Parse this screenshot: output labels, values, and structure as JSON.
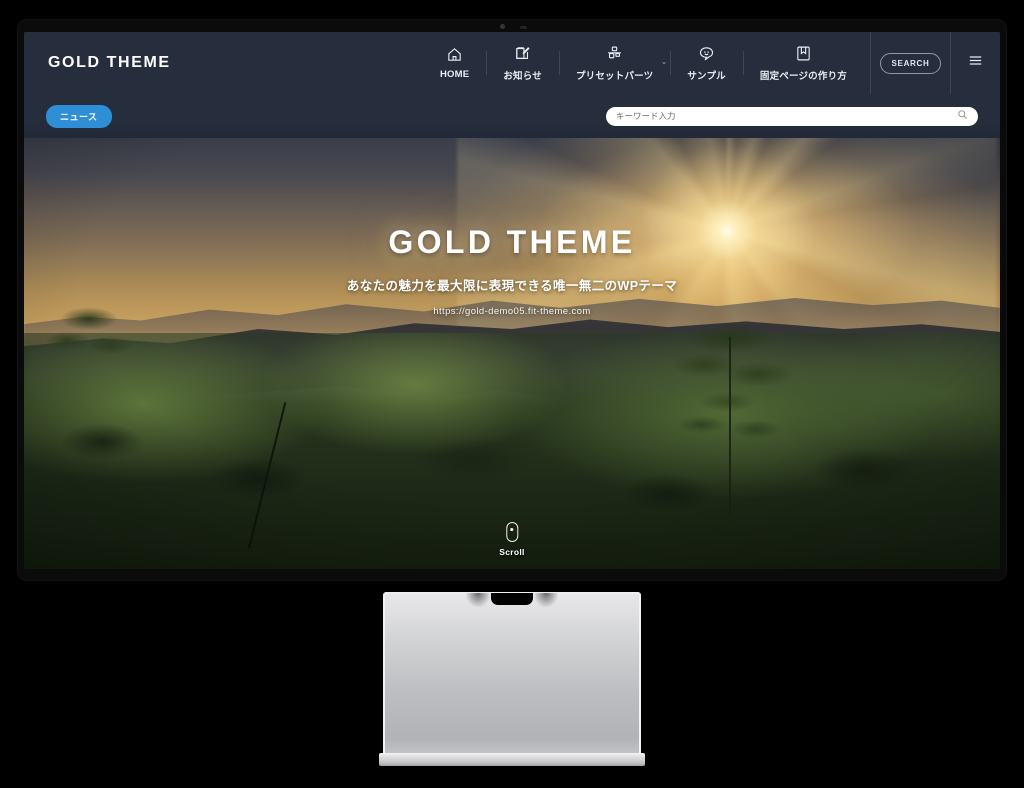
{
  "device": {
    "type": "desktop-monitor-with-stand",
    "bezel_color": "#0b0b0c",
    "stand_color": "#c9cacd"
  },
  "site": {
    "logo": "GOLD THEME",
    "header_bg": "#262e3e",
    "accent": "#2f8fd6",
    "nav": [
      {
        "label": "HOME",
        "icon": "home-icon",
        "has_dropdown": false
      },
      {
        "label": "お知らせ",
        "icon": "edit-square-icon",
        "has_dropdown": false
      },
      {
        "label": "プリセットパーツ",
        "icon": "puzzle-parts-icon",
        "has_dropdown": true,
        "caret": "⌄"
      },
      {
        "label": "サンプル",
        "icon": "chat-smile-icon",
        "has_dropdown": false
      },
      {
        "label": "固定ページの作り方",
        "icon": "bookmark-icon",
        "has_dropdown": false
      }
    ],
    "search_button": "SEARCH",
    "menu_icon": "hamburger-list-icon",
    "news_badge": "ニュース",
    "search": {
      "placeholder": "キーワード入力",
      "value": "",
      "icon": "magnifier-icon"
    },
    "hero": {
      "title": "GOLD THEME",
      "subtitle": "あなたの魅力を最大限に表現できる唯一無二のWPテーマ",
      "url": "https://gold-demo05.fit-theme.com",
      "scroll_label": "Scroll",
      "scroll_icon": "mouse-scroll-icon",
      "background": "sunrise-over-misty-jungle-valley-photo"
    }
  }
}
